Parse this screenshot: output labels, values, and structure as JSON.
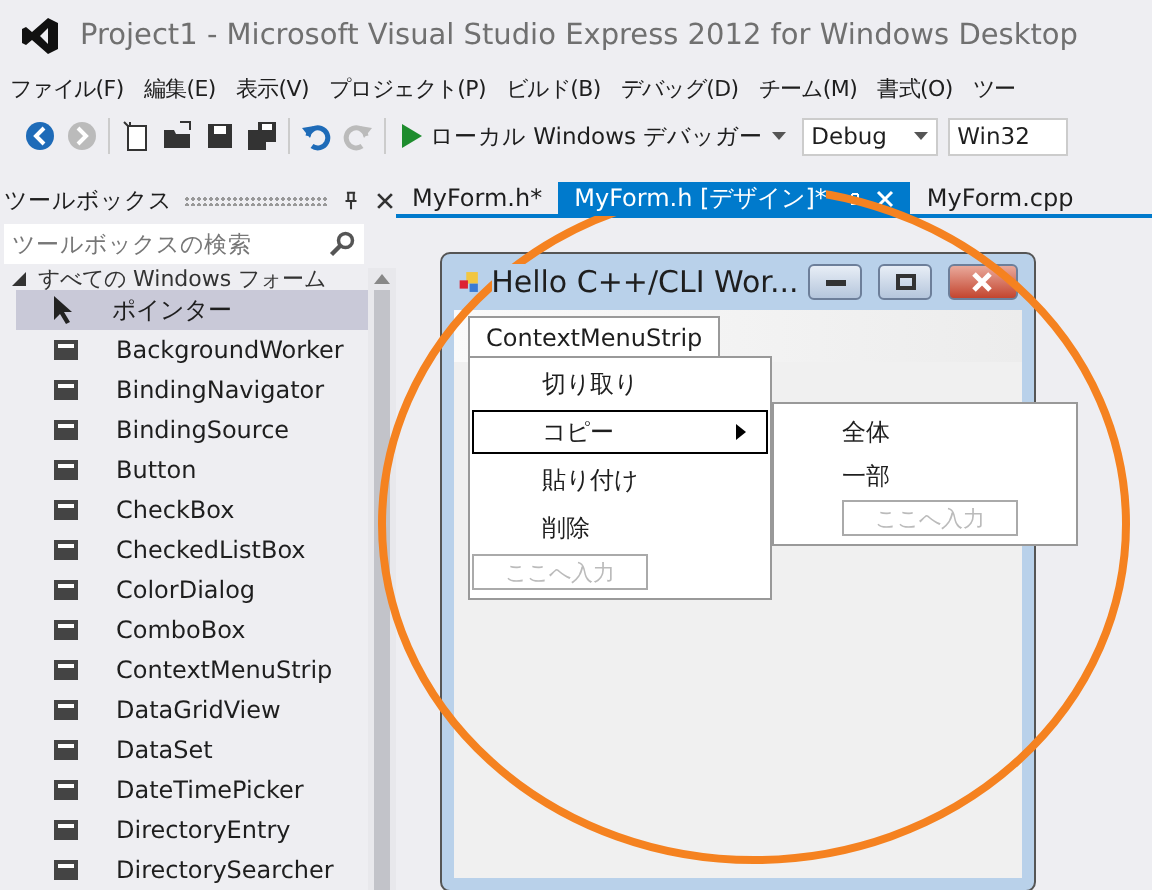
{
  "window": {
    "title": "Project1 - Microsoft Visual Studio Express 2012 for Windows Desktop"
  },
  "menu": [
    "ファイル(F)",
    "編集(E)",
    "表示(V)",
    "プロジェクト(P)",
    "ビルド(B)",
    "デバッグ(D)",
    "チーム(M)",
    "書式(O)",
    "ツー"
  ],
  "toolbar": {
    "debugger": "ローカル Windows デバッガー",
    "configuration": "Debug",
    "platform": "Win32"
  },
  "toolbox": {
    "title": "ツールボックス",
    "search": {
      "placeholder": "ツールボックスの検索"
    },
    "group": {
      "label": "すべての Windows フォーム",
      "expanded": true
    },
    "items": [
      {
        "label": "ポインター",
        "kind": "pointer",
        "selected": true
      },
      {
        "label": "BackgroundWorker",
        "kind": "component",
        "selected": false
      },
      {
        "label": "BindingNavigator",
        "kind": "component",
        "selected": false
      },
      {
        "label": "BindingSource",
        "kind": "component",
        "selected": false
      },
      {
        "label": "Button",
        "kind": "component",
        "selected": false
      },
      {
        "label": "CheckBox",
        "kind": "component",
        "selected": false
      },
      {
        "label": "CheckedListBox",
        "kind": "component",
        "selected": false
      },
      {
        "label": "ColorDialog",
        "kind": "component",
        "selected": false
      },
      {
        "label": "ComboBox",
        "kind": "component",
        "selected": false
      },
      {
        "label": "ContextMenuStrip",
        "kind": "component",
        "selected": false
      },
      {
        "label": "DataGridView",
        "kind": "component",
        "selected": false
      },
      {
        "label": "DataSet",
        "kind": "component",
        "selected": false
      },
      {
        "label": "DateTimePicker",
        "kind": "component",
        "selected": false
      },
      {
        "label": "DirectoryEntry",
        "kind": "component",
        "selected": false
      },
      {
        "label": "DirectorySearcher",
        "kind": "component",
        "selected": false
      }
    ]
  },
  "tabs": [
    {
      "label": "MyForm.h*",
      "selected": false
    },
    {
      "label": "MyForm.h [デザイン]*",
      "selected": true
    },
    {
      "label": "MyForm.cpp",
      "selected": false
    }
  ],
  "form": {
    "title": "Hello C++/CLI Wor...",
    "strip_label": "ContextMenuStrip",
    "menu_items": [
      {
        "label": "切り取り",
        "selected": false,
        "has_submenu": false
      },
      {
        "label": "コピー",
        "selected": true,
        "has_submenu": true
      },
      {
        "label": "貼り付け",
        "selected": false,
        "has_submenu": false
      },
      {
        "label": "削除",
        "selected": false,
        "has_submenu": false
      }
    ],
    "menu_placeholder": "ここへ入力",
    "submenu_items": [
      "全体",
      "一部"
    ],
    "submenu_placeholder": "ここへ入力"
  }
}
